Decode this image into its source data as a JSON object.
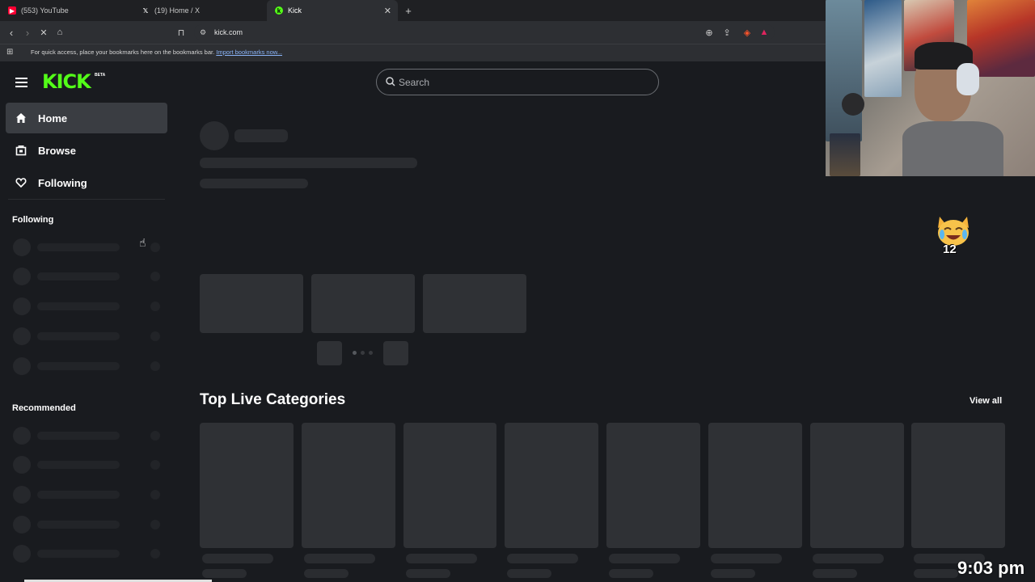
{
  "browser": {
    "tabs": [
      {
        "label": "(553) YouTube",
        "color": "#ff0033",
        "icon": "youtube-icon"
      },
      {
        "label": "(19) Home / X",
        "color": "#ffffff",
        "icon": "x-icon"
      },
      {
        "label": "Kick",
        "color": "#53fc18",
        "icon": "kick-icon",
        "active": true
      }
    ],
    "url": "kick.com",
    "bookmarks_msg": "For quick access, place your bookmarks here on the bookmarks bar.",
    "bookmarks_link": "Import bookmarks now..."
  },
  "kick": {
    "logo": "KICK",
    "beta": "BETA",
    "nav": [
      {
        "label": "Home",
        "icon": "home-icon",
        "active": true
      },
      {
        "label": "Browse",
        "icon": "browse-icon"
      },
      {
        "label": "Following",
        "icon": "heart-icon"
      }
    ],
    "following_title": "Following",
    "recommended_title": "Recommended",
    "search_placeholder": "Search",
    "top_categories_title": "Top Live Categories",
    "view_all": "View all"
  },
  "overlay": {
    "clock": "9:03 pm",
    "emote_text": "12"
  },
  "colors": {
    "accent": "#53fc18",
    "background": "#191b1f",
    "skeleton": "#2f3135"
  }
}
